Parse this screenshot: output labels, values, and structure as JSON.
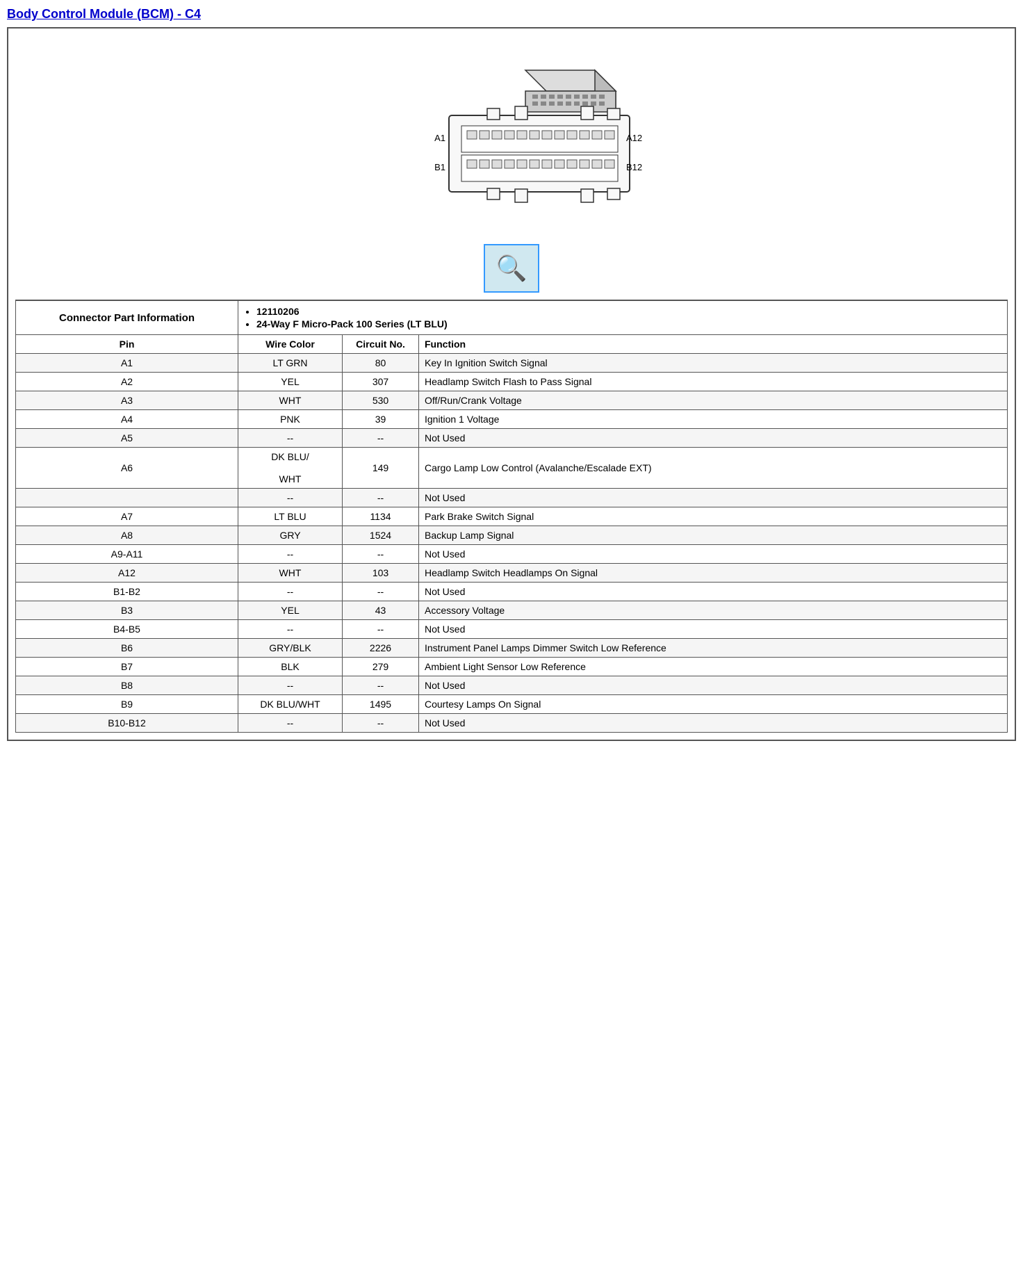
{
  "title": "Body Control Module (BCM) - C4",
  "connector_info": {
    "label": "Connector Part Information",
    "parts": [
      "12110206",
      "24-Way F Micro-Pack 100 Series (LT BLU)"
    ]
  },
  "table": {
    "headers": [
      "Pin",
      "Wire Color",
      "Circuit No.",
      "Function"
    ],
    "rows": [
      {
        "pin": "A1",
        "wire": "LT GRN",
        "circuit": "80",
        "function": "Key In Ignition Switch Signal"
      },
      {
        "pin": "A2",
        "wire": "YEL",
        "circuit": "307",
        "function": "Headlamp Switch Flash to Pass Signal"
      },
      {
        "pin": "A3",
        "wire": "WHT",
        "circuit": "530",
        "function": "Off/Run/Crank Voltage"
      },
      {
        "pin": "A4",
        "wire": "PNK",
        "circuit": "39",
        "function": "Ignition 1 Voltage"
      },
      {
        "pin": "A5",
        "wire": "--",
        "circuit": "--",
        "function": "Not Used"
      },
      {
        "pin": "A6",
        "wire": "DK BLU/\n\nWHT",
        "circuit": "149",
        "function": "Cargo Lamp Low Control (Avalanche/Escalade EXT)"
      },
      {
        "pin": "",
        "wire": "--",
        "circuit": "--",
        "function": "Not Used"
      },
      {
        "pin": "A7",
        "wire": "LT BLU",
        "circuit": "1134",
        "function": "Park Brake Switch Signal"
      },
      {
        "pin": "A8",
        "wire": "GRY",
        "circuit": "1524",
        "function": "Backup Lamp Signal"
      },
      {
        "pin": "A9-A11",
        "wire": "--",
        "circuit": "--",
        "function": "Not Used"
      },
      {
        "pin": "A12",
        "wire": "WHT",
        "circuit": "103",
        "function": "Headlamp Switch Headlamps On Signal"
      },
      {
        "pin": "B1-B2",
        "wire": "--",
        "circuit": "--",
        "function": "Not Used"
      },
      {
        "pin": "B3",
        "wire": "YEL",
        "circuit": "43",
        "function": "Accessory Voltage"
      },
      {
        "pin": "B4-B5",
        "wire": "--",
        "circuit": "--",
        "function": "Not Used"
      },
      {
        "pin": "B6",
        "wire": "GRY/BLK",
        "circuit": "2226",
        "function": "Instrument Panel Lamps Dimmer Switch Low Reference"
      },
      {
        "pin": "B7",
        "wire": "BLK",
        "circuit": "279",
        "function": "Ambient Light Sensor Low Reference"
      },
      {
        "pin": "B8",
        "wire": "--",
        "circuit": "--",
        "function": "Not Used"
      },
      {
        "pin": "B9",
        "wire": "DK BLU/WHT",
        "circuit": "1495",
        "function": "Courtesy Lamps On Signal"
      },
      {
        "pin": "B10-B12",
        "wire": "--",
        "circuit": "--",
        "function": "Not Used"
      }
    ]
  }
}
